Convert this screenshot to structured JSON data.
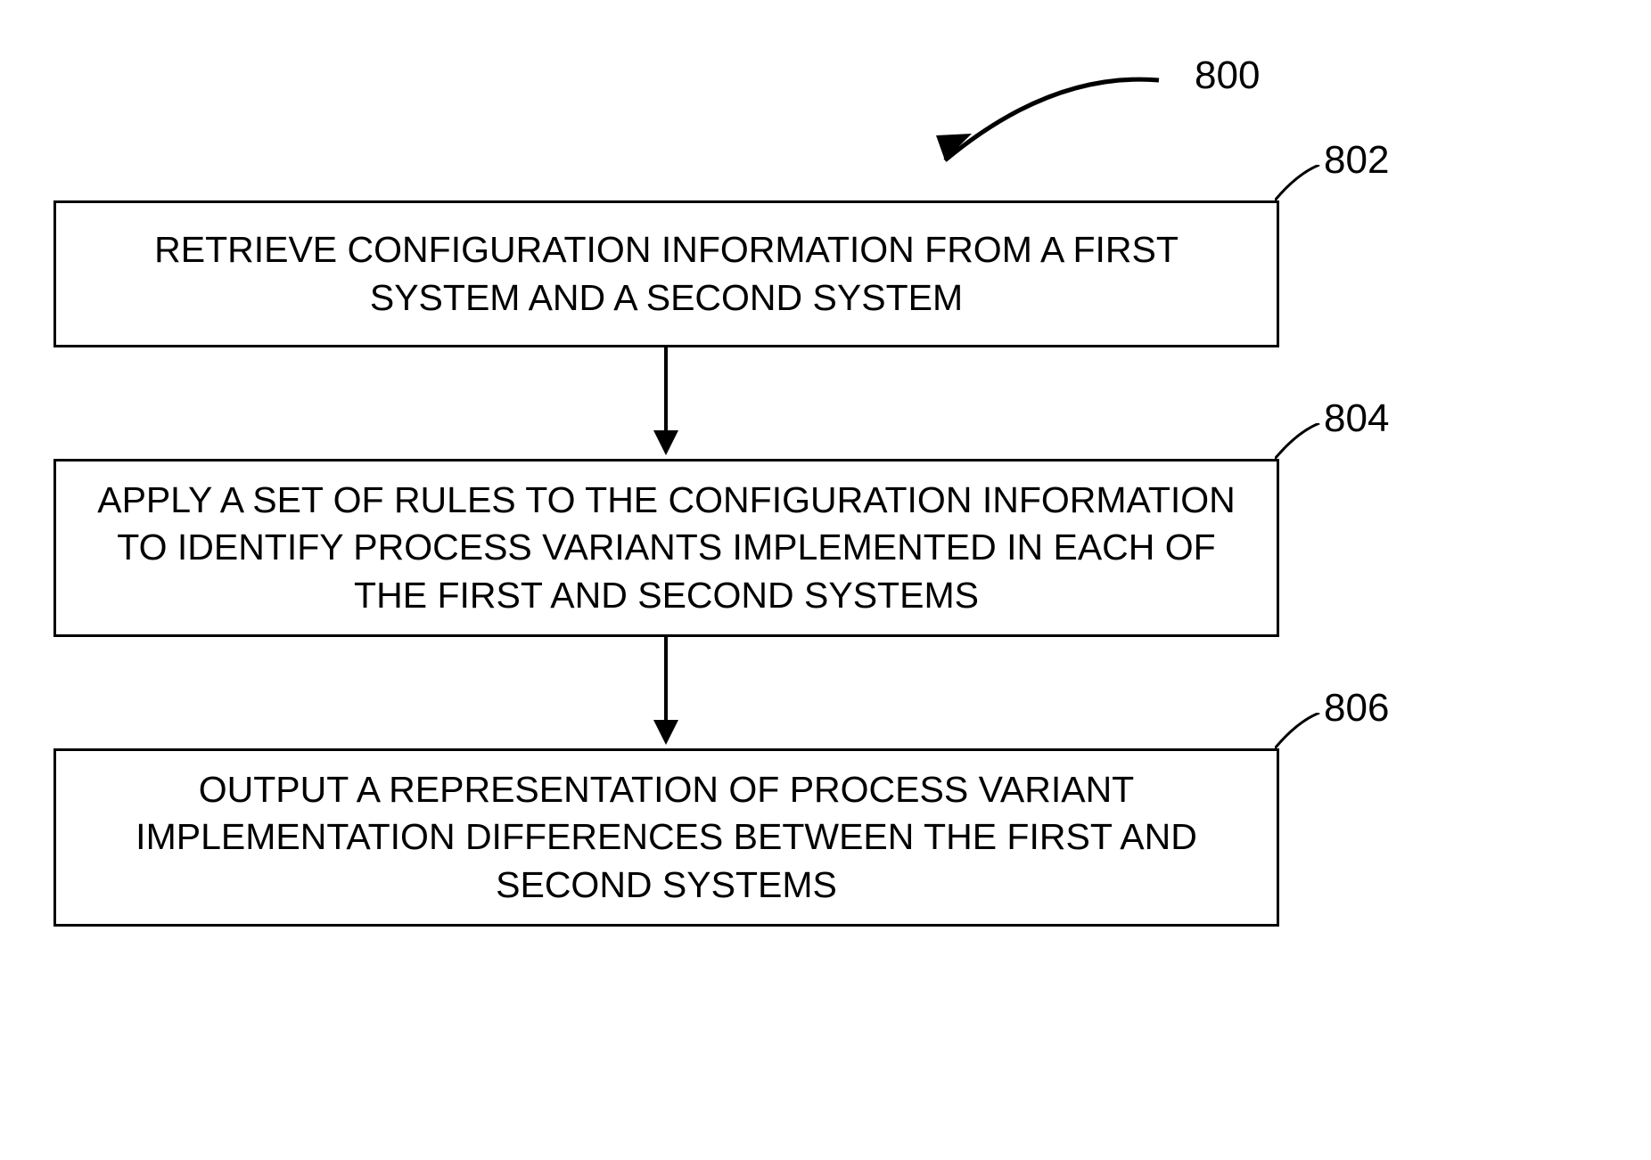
{
  "labels": {
    "figure": "800",
    "box1": "802",
    "box2": "804",
    "box3": "806"
  },
  "boxes": {
    "b1": "RETRIEVE CONFIGURATION INFORMATION FROM A FIRST SYSTEM AND A SECOND SYSTEM",
    "b2": "APPLY A SET OF RULES TO THE CONFIGURATION INFORMATION TO IDENTIFY PROCESS VARIANTS IMPLEMENTED IN EACH OF THE FIRST AND SECOND SYSTEMS",
    "b3": "OUTPUT A REPRESENTATION OF PROCESS VARIANT IMPLEMENTATION DIFFERENCES BETWEEN THE FIRST AND SECOND SYSTEMS"
  }
}
